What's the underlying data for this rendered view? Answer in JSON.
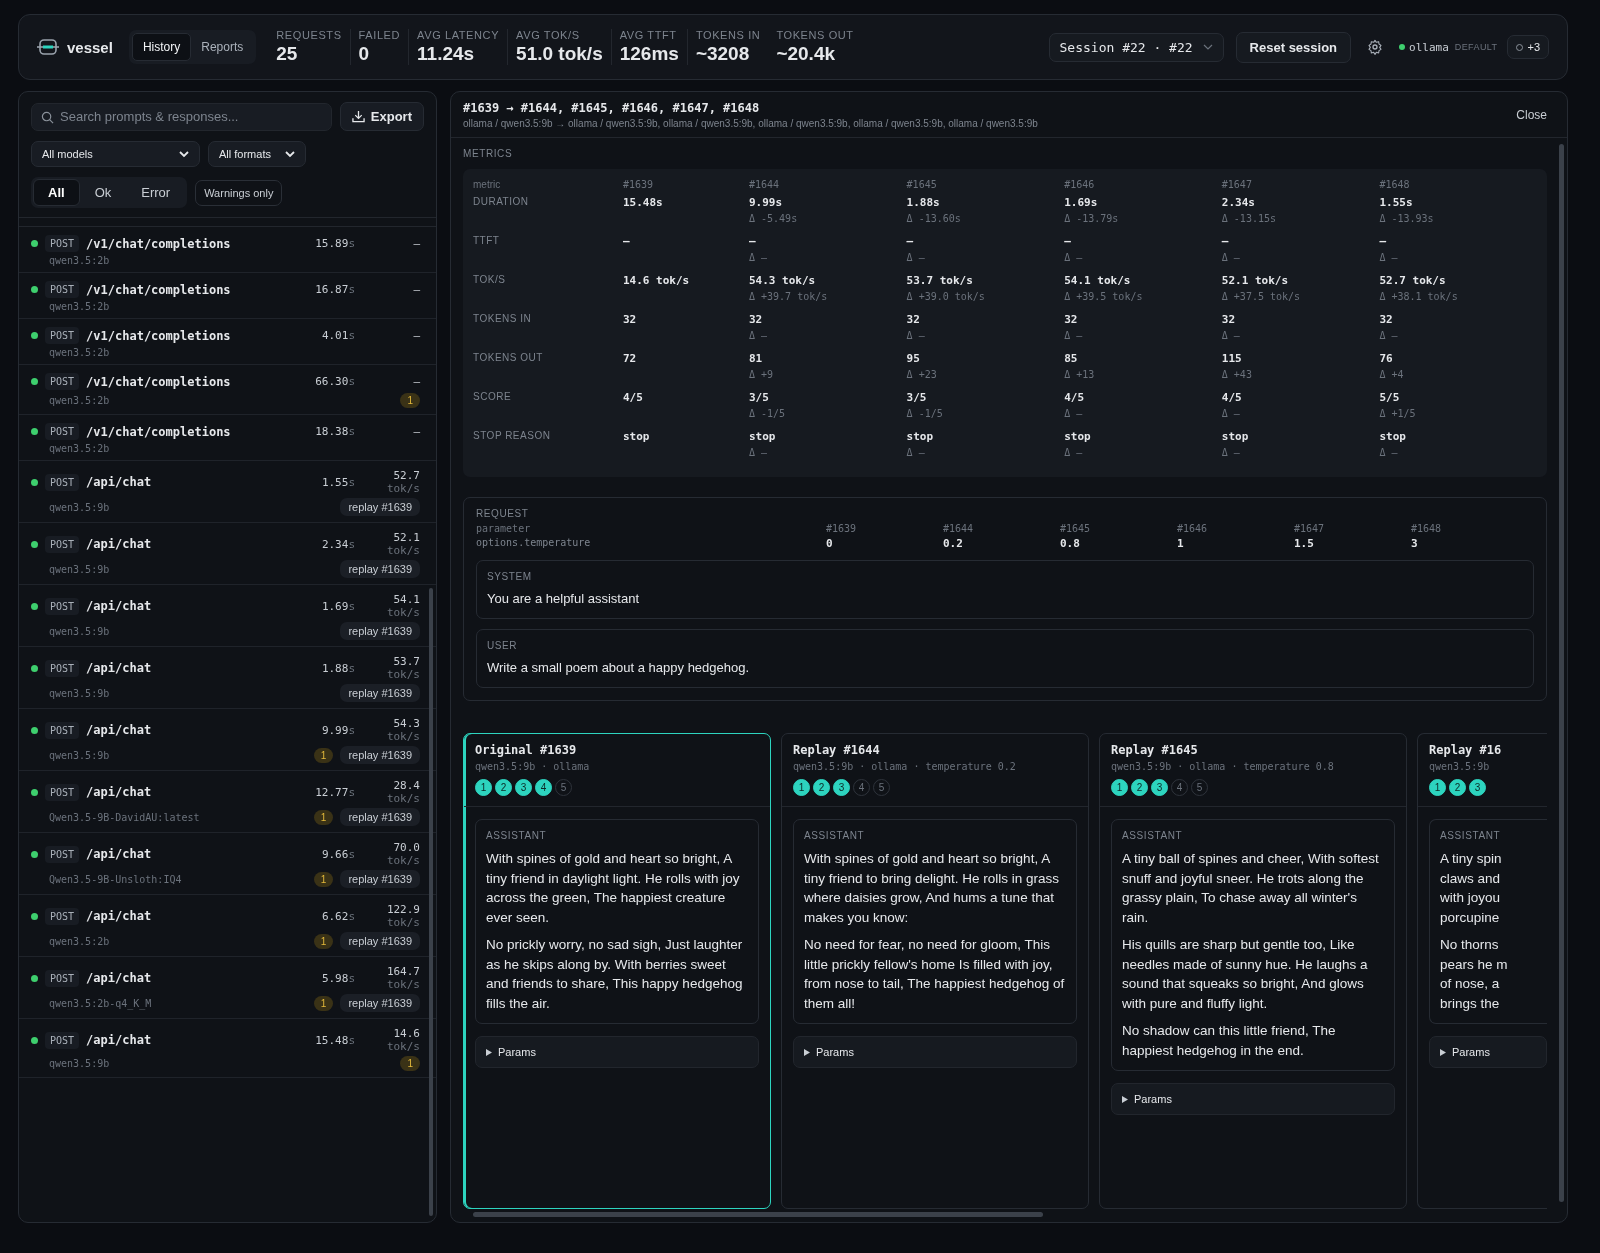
{
  "app": {
    "name": "vessel",
    "tabs": [
      {
        "label": "History",
        "selected": true
      },
      {
        "label": "Reports",
        "selected": false
      }
    ]
  },
  "stats": [
    {
      "label": "REQUESTS",
      "value": "25"
    },
    {
      "label": "FAILED",
      "value": "0"
    },
    {
      "label": "AVG LATENCY",
      "value": "11.24s"
    },
    {
      "label": "AVG TOK/S",
      "value": "51.0 tok/s"
    },
    {
      "label": "AVG TTFT",
      "value": "126ms"
    },
    {
      "label": "TOKENS IN",
      "value": "~3208"
    },
    {
      "label": "TOKENS OUT",
      "value": "~20.4k"
    }
  ],
  "session_select": {
    "value": "Session #22 · #22"
  },
  "reset_button": "Reset session",
  "provider": {
    "name": "ollama",
    "badge": "DEFAULT",
    "online": true
  },
  "providers_more": "+3",
  "sidebar": {
    "search": {
      "placeholder": "Search prompts & responses..."
    },
    "export_button": "Export",
    "model_filter": "All models",
    "format_filter": "All formats",
    "status_filters": [
      {
        "label": "All",
        "selected": true
      },
      {
        "label": "Ok",
        "selected": false
      },
      {
        "label": "Error",
        "selected": false
      }
    ],
    "warnings_toggle": {
      "label": "Warnings only",
      "on": false
    },
    "requests": [
      {
        "ok": true,
        "method": "POST",
        "path": "/v1/chat/completions",
        "model": "qwen3.5:2b",
        "duration": "15.89",
        "duration_unit": "s",
        "rate": "—"
      },
      {
        "ok": true,
        "method": "POST",
        "path": "/v1/chat/completions",
        "model": "qwen3.5:2b",
        "duration": "16.87",
        "duration_unit": "s",
        "rate": "—"
      },
      {
        "ok": true,
        "method": "POST",
        "path": "/v1/chat/completions",
        "model": "qwen3.5:2b",
        "duration": "4.01",
        "duration_unit": "s",
        "rate": "—"
      },
      {
        "ok": true,
        "method": "POST",
        "path": "/v1/chat/completions",
        "model": "qwen3.5:2b",
        "duration": "66.30",
        "duration_unit": "s",
        "rate": "—",
        "warnings": "1"
      },
      {
        "ok": true,
        "method": "POST",
        "path": "/v1/chat/completions",
        "model": "qwen3.5:2b",
        "duration": "18.38",
        "duration_unit": "s",
        "rate": "—"
      },
      {
        "ok": true,
        "method": "POST",
        "path": "/api/chat",
        "model": "qwen3.5:9b",
        "duration": "1.55",
        "duration_unit": "s",
        "rate": "52.7",
        "rate_unit": "tok/s",
        "replay": "replay #1639"
      },
      {
        "ok": true,
        "method": "POST",
        "path": "/api/chat",
        "model": "qwen3.5:9b",
        "duration": "2.34",
        "duration_unit": "s",
        "rate": "52.1",
        "rate_unit": "tok/s",
        "replay": "replay #1639"
      },
      {
        "ok": true,
        "method": "POST",
        "path": "/api/chat",
        "model": "qwen3.5:9b",
        "duration": "1.69",
        "duration_unit": "s",
        "rate": "54.1",
        "rate_unit": "tok/s",
        "replay": "replay #1639"
      },
      {
        "ok": true,
        "method": "POST",
        "path": "/api/chat",
        "model": "qwen3.5:9b",
        "duration": "1.88",
        "duration_unit": "s",
        "rate": "53.7",
        "rate_unit": "tok/s",
        "replay": "replay #1639"
      },
      {
        "ok": true,
        "method": "POST",
        "path": "/api/chat",
        "model": "qwen3.5:9b",
        "duration": "9.99",
        "duration_unit": "s",
        "rate": "54.3",
        "rate_unit": "tok/s",
        "warnings": "1",
        "replay": "replay #1639"
      },
      {
        "ok": true,
        "method": "POST",
        "path": "/api/chat",
        "model": "Qwen3.5-9B-DavidAU:latest",
        "duration": "12.77",
        "duration_unit": "s",
        "rate": "28.4",
        "rate_unit": "tok/s",
        "warnings": "1",
        "replay": "replay #1639"
      },
      {
        "ok": true,
        "method": "POST",
        "path": "/api/chat",
        "model": "Qwen3.5-9B-Unsloth:IQ4",
        "duration": "9.66",
        "duration_unit": "s",
        "rate": "70.0",
        "rate_unit": "tok/s",
        "warnings": "1",
        "replay": "replay #1639"
      },
      {
        "ok": true,
        "method": "POST",
        "path": "/api/chat",
        "model": "qwen3.5:2b",
        "duration": "6.62",
        "duration_unit": "s",
        "rate": "122.9",
        "rate_unit": "tok/s",
        "warnings": "1",
        "replay": "replay #1639"
      },
      {
        "ok": true,
        "method": "POST",
        "path": "/api/chat",
        "model": "qwen3.5:2b-q4_K_M",
        "duration": "5.98",
        "duration_unit": "s",
        "rate": "164.7",
        "rate_unit": "tok/s",
        "warnings": "1",
        "replay": "replay #1639"
      },
      {
        "ok": true,
        "method": "POST",
        "path": "/api/chat",
        "model": "qwen3.5:9b",
        "duration": "15.48",
        "duration_unit": "s",
        "rate": "14.6",
        "rate_unit": "tok/s",
        "warnings": "1"
      }
    ]
  },
  "comparison": {
    "title": "#1639 → #1644, #1645, #1646, #1647, #1648",
    "subtitle": "ollama / qwen3.5:9b → ollama / qwen3.5:9b, ollama / qwen3.5:9b, ollama / qwen3.5:9b, ollama / qwen3.5:9b, ollama / qwen3.5:9b",
    "close_button": "Close",
    "metrics": {
      "title": "METRICS",
      "columns": [
        "metric",
        "#1639",
        "#1644",
        "#1645",
        "#1646",
        "#1647",
        "#1648"
      ],
      "rows": [
        {
          "cells": [
            {
              "value": "DURATION"
            },
            {
              "value": "15.48s"
            },
            {
              "value": "9.99s",
              "delta": "Δ -5.49s"
            },
            {
              "value": "1.88s",
              "delta": "Δ -13.60s"
            },
            {
              "value": "1.69s",
              "delta": "Δ -13.79s"
            },
            {
              "value": "2.34s",
              "delta": "Δ -13.15s"
            },
            {
              "value": "1.55s",
              "delta": "Δ -13.93s"
            }
          ]
        },
        {
          "cells": [
            {
              "value": "TTFT"
            },
            {
              "value": "—"
            },
            {
              "value": "—",
              "delta": "Δ —"
            },
            {
              "value": "—",
              "delta": "Δ —"
            },
            {
              "value": "—",
              "delta": "Δ —"
            },
            {
              "value": "—",
              "delta": "Δ —"
            },
            {
              "value": "—",
              "delta": "Δ —"
            }
          ]
        },
        {
          "cells": [
            {
              "value": "TOK/S"
            },
            {
              "value": "14.6 tok/s"
            },
            {
              "value": "54.3 tok/s",
              "delta": "Δ +39.7 tok/s"
            },
            {
              "value": "53.7 tok/s",
              "delta": "Δ +39.0 tok/s"
            },
            {
              "value": "54.1 tok/s",
              "delta": "Δ +39.5 tok/s"
            },
            {
              "value": "52.1 tok/s",
              "delta": "Δ +37.5 tok/s"
            },
            {
              "value": "52.7 tok/s",
              "delta": "Δ +38.1 tok/s"
            }
          ]
        },
        {
          "cells": [
            {
              "value": "TOKENS IN"
            },
            {
              "value": "32"
            },
            {
              "value": "32",
              "delta": "Δ —"
            },
            {
              "value": "32",
              "delta": "Δ —"
            },
            {
              "value": "32",
              "delta": "Δ —"
            },
            {
              "value": "32",
              "delta": "Δ —"
            },
            {
              "value": "32",
              "delta": "Δ —"
            }
          ]
        },
        {
          "cells": [
            {
              "value": "TOKENS OUT"
            },
            {
              "value": "72"
            },
            {
              "value": "81",
              "delta": "Δ +9"
            },
            {
              "value": "95",
              "delta": "Δ +23"
            },
            {
              "value": "85",
              "delta": "Δ +13"
            },
            {
              "value": "115",
              "delta": "Δ +43"
            },
            {
              "value": "76",
              "delta": "Δ +4"
            }
          ]
        },
        {
          "cells": [
            {
              "value": "SCORE"
            },
            {
              "value": "4/5"
            },
            {
              "value": "3/5",
              "delta": "Δ -1/5"
            },
            {
              "value": "3/5",
              "delta": "Δ -1/5"
            },
            {
              "value": "4/5",
              "delta": "Δ —"
            },
            {
              "value": "4/5",
              "delta": "Δ —"
            },
            {
              "value": "5/5",
              "delta": "Δ +1/5"
            }
          ]
        },
        {
          "cells": [
            {
              "value": "STOP REASON"
            },
            {
              "value": "stop"
            },
            {
              "value": "stop",
              "delta": "Δ —"
            },
            {
              "value": "stop",
              "delta": "Δ —"
            },
            {
              "value": "stop",
              "delta": "Δ —"
            },
            {
              "value": "stop",
              "delta": "Δ —"
            },
            {
              "value": "stop",
              "delta": "Δ —"
            }
          ]
        }
      ]
    },
    "request": {
      "title": "REQUEST",
      "columns": [
        "parameter",
        "#1639",
        "#1644",
        "#1645",
        "#1646",
        "#1647",
        "#1648"
      ],
      "rows": [
        {
          "label": "options.temperature",
          "values": [
            "0",
            "0.2",
            "0.8",
            "1",
            "1.5",
            "3"
          ]
        }
      ],
      "messages": [
        {
          "role": "SYSTEM",
          "text": "You are a helpful assistant"
        },
        {
          "role": "USER",
          "text": "Write a small poem about a happy hedgehog."
        }
      ]
    },
    "responses": [
      {
        "title": "Original #1639",
        "meta": "qwen3.5:9b · ollama",
        "selected": true,
        "scores": [
          {
            "label": "1",
            "filled": true
          },
          {
            "label": "2",
            "filled": true
          },
          {
            "label": "3",
            "filled": true
          },
          {
            "label": "4",
            "filled": true
          },
          {
            "label": "5",
            "filled": false
          }
        ],
        "role": "ASSISTANT",
        "paragraphs": [
          "With spines of gold and heart so bright, A tiny friend in daylight light. He rolls with joy across the green, The happiest creature ever seen.",
          "No prickly worry, no sad sigh, Just laughter as he skips along by. With berries sweet and friends to share, This happy hedgehog fills the air."
        ],
        "params": "Params"
      },
      {
        "title": "Replay #1644",
        "meta": "qwen3.5:9b · ollama · temperature 0.2",
        "selected": false,
        "scores": [
          {
            "label": "1",
            "filled": true
          },
          {
            "label": "2",
            "filled": true
          },
          {
            "label": "3",
            "filled": true
          },
          {
            "label": "4",
            "filled": false
          },
          {
            "label": "5",
            "filled": false
          }
        ],
        "role": "ASSISTANT",
        "paragraphs": [
          "With spines of gold and heart so bright, A tiny friend to bring delight. He rolls in grass where daisies grow, And hums a tune that makes you know:",
          "No need for fear, no need for gloom, This little prickly fellow's home Is filled with joy, from nose to tail, The happiest hedgehog of them all!"
        ],
        "params": "Params"
      },
      {
        "title": "Replay #1645",
        "meta": "qwen3.5:9b · ollama · temperature 0.8",
        "selected": false,
        "scores": [
          {
            "label": "1",
            "filled": true
          },
          {
            "label": "2",
            "filled": true
          },
          {
            "label": "3",
            "filled": true
          },
          {
            "label": "4",
            "filled": false
          },
          {
            "label": "5",
            "filled": false
          }
        ],
        "role": "ASSISTANT",
        "paragraphs": [
          "A tiny ball of spines and cheer, With softest snuff and joyful sneer. He trots along the grassy plain, To chase away all winter's rain.",
          "His quills are sharp but gentle too, Like needles made of sunny hue. He laughs a sound that squeaks so bright, And glows with pure and fluffy light.",
          "No shadow can this little friend, The happiest hedgehog in the end."
        ],
        "params": "Params"
      },
      {
        "title": "Replay #16",
        "meta": "qwen3.5:9b",
        "selected": false,
        "scores": [
          {
            "label": "1",
            "filled": true
          },
          {
            "label": "2",
            "filled": true
          },
          {
            "label": "3",
            "filled": true
          }
        ],
        "role": "ASSISTANT",
        "paragraphs": [
          [
            "A tiny spin",
            "claws and",
            "with joyou",
            "porcupine"
          ],
          [
            "No thorns",
            "pears he m",
            "of nose, a",
            "brings the"
          ]
        ],
        "params": "Params"
      }
    ]
  }
}
